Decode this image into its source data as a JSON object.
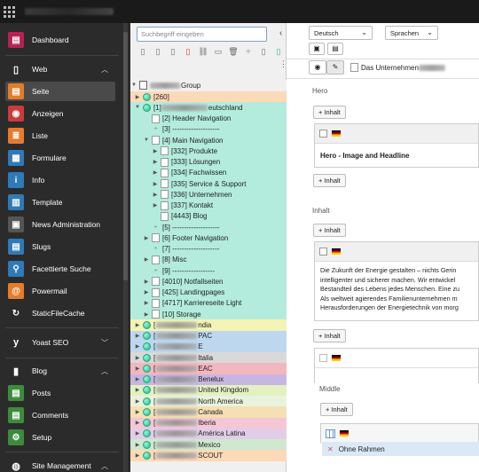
{
  "sidebar": {
    "items": [
      {
        "label": "Dashboard",
        "icon": "dashboard-icon",
        "color": "#b72153"
      },
      {
        "label": "Seite",
        "icon": "page-icon",
        "color": "#e67c2b"
      },
      {
        "label": "Anzeigen",
        "icon": "eye-icon",
        "color": "#c83c3c"
      },
      {
        "label": "Liste",
        "icon": "list-icon",
        "color": "#e67c2b"
      },
      {
        "label": "Formulare",
        "icon": "form-icon",
        "color": "#2f7ab8"
      },
      {
        "label": "Info",
        "icon": "info-icon",
        "color": "#2f7ab8"
      },
      {
        "label": "Template",
        "icon": "template-icon",
        "color": "#2f7ab8"
      },
      {
        "label": "News Administration",
        "icon": "news-icon",
        "color": "#555"
      },
      {
        "label": "Slugs",
        "icon": "slugs-icon",
        "color": "#2f7ab8"
      },
      {
        "label": "Facettierte Suche",
        "icon": "binoculars-icon",
        "color": "#2f7ab8"
      },
      {
        "label": "Powermail",
        "icon": "powermail-icon",
        "color": "#e67c2b"
      },
      {
        "label": "StaticFileCache",
        "icon": "cache-icon",
        "color": "#2b2b2b"
      },
      {
        "label": "Posts",
        "icon": "posts-icon",
        "color": "#3c8c3c"
      },
      {
        "label": "Comments",
        "icon": "comments-icon",
        "color": "#3c8c3c"
      },
      {
        "label": "Setup",
        "icon": "setup-icon",
        "color": "#3c8c3c"
      }
    ],
    "groups": {
      "web": "Web",
      "yoast": "Yoast SEO",
      "blog": "Blog",
      "site": "Site Management"
    }
  },
  "tree": {
    "search_placeholder": "Suchbegriff eingeben",
    "root": "Group",
    "nodes": [
      {
        "label": "[260]",
        "bg": "#fcd9b7"
      },
      {
        "label": "[1]",
        "suffix": "eutschland",
        "bg": "#b3ecdc"
      },
      {
        "label": "[2] Header Navigation",
        "bg": "#b3ecdc"
      },
      {
        "label": "[3] --------------------",
        "bg": "#b3ecdc"
      },
      {
        "label": "[4] Main Navigation",
        "bg": "#b3ecdc"
      },
      {
        "label": "[332] Produkte",
        "bg": "#b3ecdc"
      },
      {
        "label": "[333] Lösungen",
        "bg": "#b3ecdc"
      },
      {
        "label": "[334] Fachwissen",
        "bg": "#b3ecdc"
      },
      {
        "label": "[335] Service & Support",
        "bg": "#b3ecdc"
      },
      {
        "label": "[336] Unternehmen",
        "bg": "#b3ecdc"
      },
      {
        "label": "[337] Kontakt",
        "bg": "#b3ecdc"
      },
      {
        "label": "[4443] Blog",
        "bg": "#b3ecdc"
      },
      {
        "label": "[5] --------------------",
        "bg": "#b3ecdc"
      },
      {
        "label": "[6] Footer Navigation",
        "bg": "#b3ecdc"
      },
      {
        "label": "[7] --------------------",
        "bg": "#b3ecdc"
      },
      {
        "label": "[8] Misc",
        "bg": "#b3ecdc"
      },
      {
        "label": "[9] ------------------",
        "bg": "#b3ecdc"
      },
      {
        "label": "[4010] Notfallseiten",
        "bg": "#b3ecdc"
      },
      {
        "label": "[425] Landingpages",
        "bg": "#b3ecdc"
      },
      {
        "label": "[4717] Karriereseite Light",
        "bg": "#b3ecdc"
      },
      {
        "label": "[10] Storage",
        "bg": "#b3ecdc"
      },
      {
        "label": "ndia",
        "bg": "#f3f3b5"
      },
      {
        "label": "PAC",
        "bg": "#bdd7ee"
      },
      {
        "label": "E",
        "bg": "#bdd7ee"
      },
      {
        "label": "Italia",
        "bg": "#d9d9d9"
      },
      {
        "label": "EAC",
        "bg": "#f4b6bd"
      },
      {
        "label": "Benelux",
        "bg": "#c8b6e2"
      },
      {
        "label": "United Kingdom",
        "bg": "#e3f0c2"
      },
      {
        "label": "North America",
        "bg": "#e9f3dc"
      },
      {
        "label": "Canada",
        "bg": "#f4e0b2"
      },
      {
        "label": "Iberia",
        "bg": "#f4c6d6"
      },
      {
        "label": "América Latina",
        "bg": "#e1cde8"
      },
      {
        "label": "Mexico",
        "bg": "#cfe8cf"
      },
      {
        "label": "SCOUT",
        "bg": "#fcd9b7"
      }
    ]
  },
  "main": {
    "language": "Deutsch",
    "languages_menu": "Sprachen",
    "page_title": "Das Unternehmen",
    "sections": {
      "hero": "Hero",
      "inhalt": "Inhalt",
      "middle": "Middle"
    },
    "add_label": "Inhalt",
    "hero_title": "Hero - Image and Headline",
    "paragraph": [
      "Die Zukunft der Energie gestalten – nichts Gerin",
      "intelligenter und sicherer machen. Wir entwickel",
      "Bestandteil des Lebens jedes Menschen. Eine zu",
      "Als weltweit agierendes Familienunternehmen m",
      "Herausforderungen der Energietechnik von morg"
    ],
    "frame_label": "Ohne Rahmen"
  }
}
